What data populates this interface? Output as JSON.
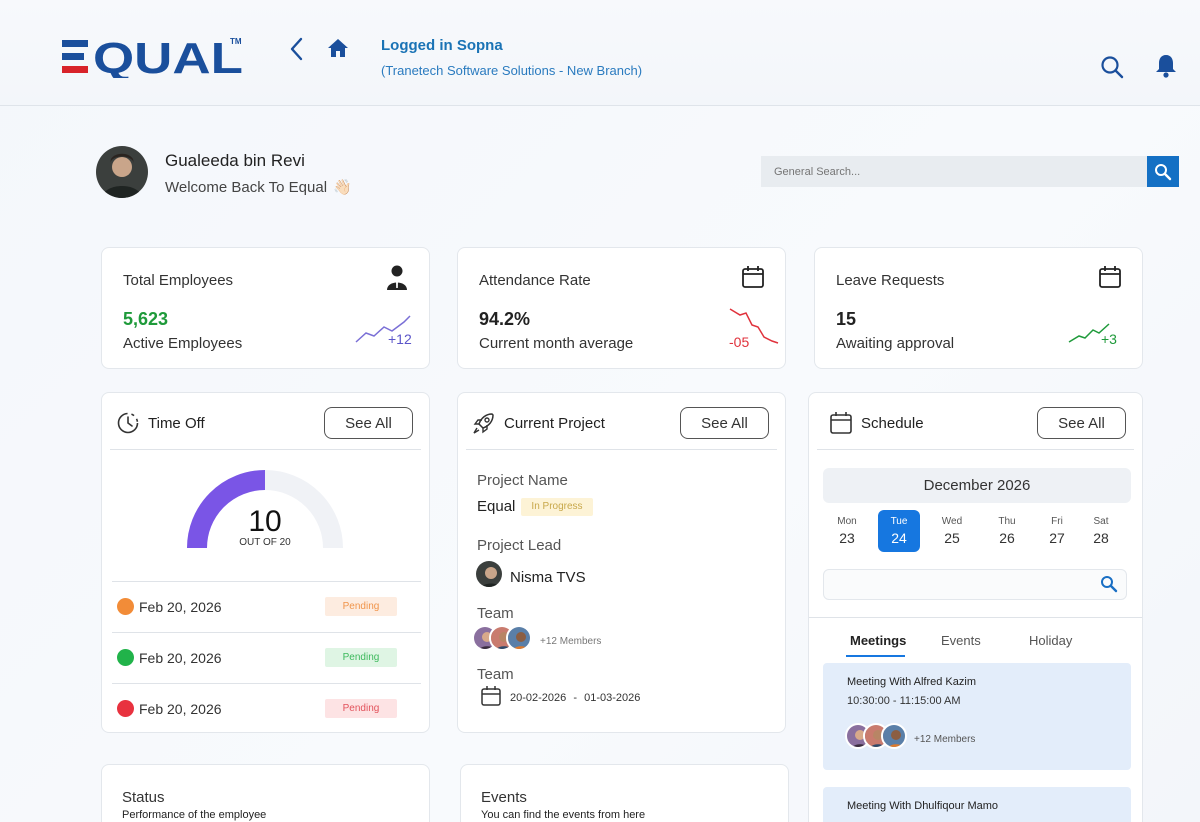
{
  "header": {
    "logo_text": "EQUAL",
    "logo_tm": "TM",
    "logged_in": "Logged in Sopna",
    "branch": "(Tranetech Software Solutions - New Branch)"
  },
  "user": {
    "name": "Gualeeda bin Revi",
    "welcome": "Welcome Back To Equal",
    "wave": "👋🏻"
  },
  "search": {
    "placeholder": "General Search..."
  },
  "stats": [
    {
      "title": "Total Employees",
      "value": "5,623",
      "sub": "Active Employees",
      "delta": "+12",
      "icon": "person-icon"
    },
    {
      "title": "Attendance Rate",
      "value": "94.2%",
      "sub": "Current month average",
      "delta": "-05",
      "icon": "calendar-icon"
    },
    {
      "title": "Leave Requests",
      "value": "15",
      "sub": "Awaiting approval",
      "delta": "+3",
      "icon": "calendar-icon"
    }
  ],
  "time_off": {
    "title": "Time Off",
    "see_all": "See All",
    "gauge_value": "10",
    "gauge_out_of": "OUT OF 20",
    "gauge_fraction": 0.5,
    "rows": [
      {
        "date": "Feb 20, 2026",
        "status": "Pending",
        "color": "#f28c38"
      },
      {
        "date": "Feb 20, 2026",
        "status": "Pending",
        "color": "#21b34a"
      },
      {
        "date": "Feb 20, 2026",
        "status": "Pending",
        "color": "#e8323f"
      }
    ]
  },
  "project": {
    "title": "Current Project",
    "see_all": "See All",
    "name_label": "Project Name",
    "name": "Equal",
    "status": "In Progress",
    "lead_label": "Project Lead",
    "lead": "Nisma TVS",
    "team_label": "Team",
    "members": "+12 Members",
    "team2_label": "Team",
    "start": "20-02-2026",
    "sep": "-",
    "end": "01-03-2026"
  },
  "schedule": {
    "title": "Schedule",
    "see_all": "See All",
    "month": "December 2026",
    "days": [
      {
        "name": "Mon",
        "date": "23"
      },
      {
        "name": "Tue",
        "date": "24"
      },
      {
        "name": "Wed",
        "date": "25"
      },
      {
        "name": "Thu",
        "date": "26"
      },
      {
        "name": "Fri",
        "date": "27"
      },
      {
        "name": "Sat",
        "date": "28"
      }
    ],
    "tabs": [
      "Meetings",
      "Events",
      "Holiday"
    ],
    "meetings": [
      {
        "title": "Meeting With Alfred Kazim",
        "time": "10:30:00 - 11:15:00 AM",
        "members": "+12 Members"
      },
      {
        "title": "Meeting With Dhulfiqour Mamo"
      }
    ]
  },
  "status_card": {
    "title": "Status",
    "sub": "Performance of the employee"
  },
  "events_card": {
    "title": "Events",
    "sub": "You can find the events from here"
  },
  "colors": {
    "brand_blue": "#1a4f9c",
    "brand_red": "#d8232a",
    "accent": "#1677e0",
    "gauge": "#7a55e6"
  }
}
